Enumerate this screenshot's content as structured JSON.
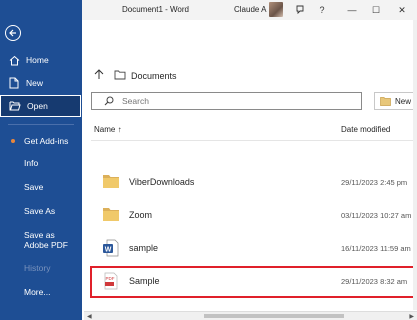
{
  "window": {
    "doc_title": "Document1  -  Word",
    "user_name": "Claude A",
    "help": "?",
    "minimize": "—",
    "maximize": "☐",
    "close": "✕"
  },
  "sidebar": {
    "items": [
      {
        "label": "Home",
        "icon": "home-icon"
      },
      {
        "label": "New",
        "icon": "new-doc-icon"
      },
      {
        "label": "Open",
        "icon": "folder-open-icon",
        "active": true
      },
      {
        "label": "Get Add-ins"
      },
      {
        "label": "Info"
      },
      {
        "label": "Save"
      },
      {
        "label": "Save As"
      },
      {
        "label": "Save as Adobe PDF"
      },
      {
        "label": "History",
        "disabled": true
      },
      {
        "label": "More..."
      }
    ]
  },
  "main": {
    "breadcrumb": "Documents",
    "search_placeholder": "Search",
    "new_folder_label": "New Fol",
    "col_name": "Name ↑",
    "col_date": "Date modified",
    "files": [
      {
        "name": "ViberDownloads",
        "date": "29/11/2023 2:45 pm",
        "type": "folder"
      },
      {
        "name": "Zoom",
        "date": "03/11/2023 10:27 am",
        "type": "folder"
      },
      {
        "name": "sample",
        "date": "16/11/2023 11:59 am",
        "type": "word"
      },
      {
        "name": "Sample",
        "date": "29/11/2023 8:32 am",
        "type": "pdf",
        "highlighted": true
      }
    ]
  },
  "colors": {
    "sidebar_bg": "#1e4e94",
    "highlight": "#e0202a",
    "folder": "#dcb05a"
  }
}
